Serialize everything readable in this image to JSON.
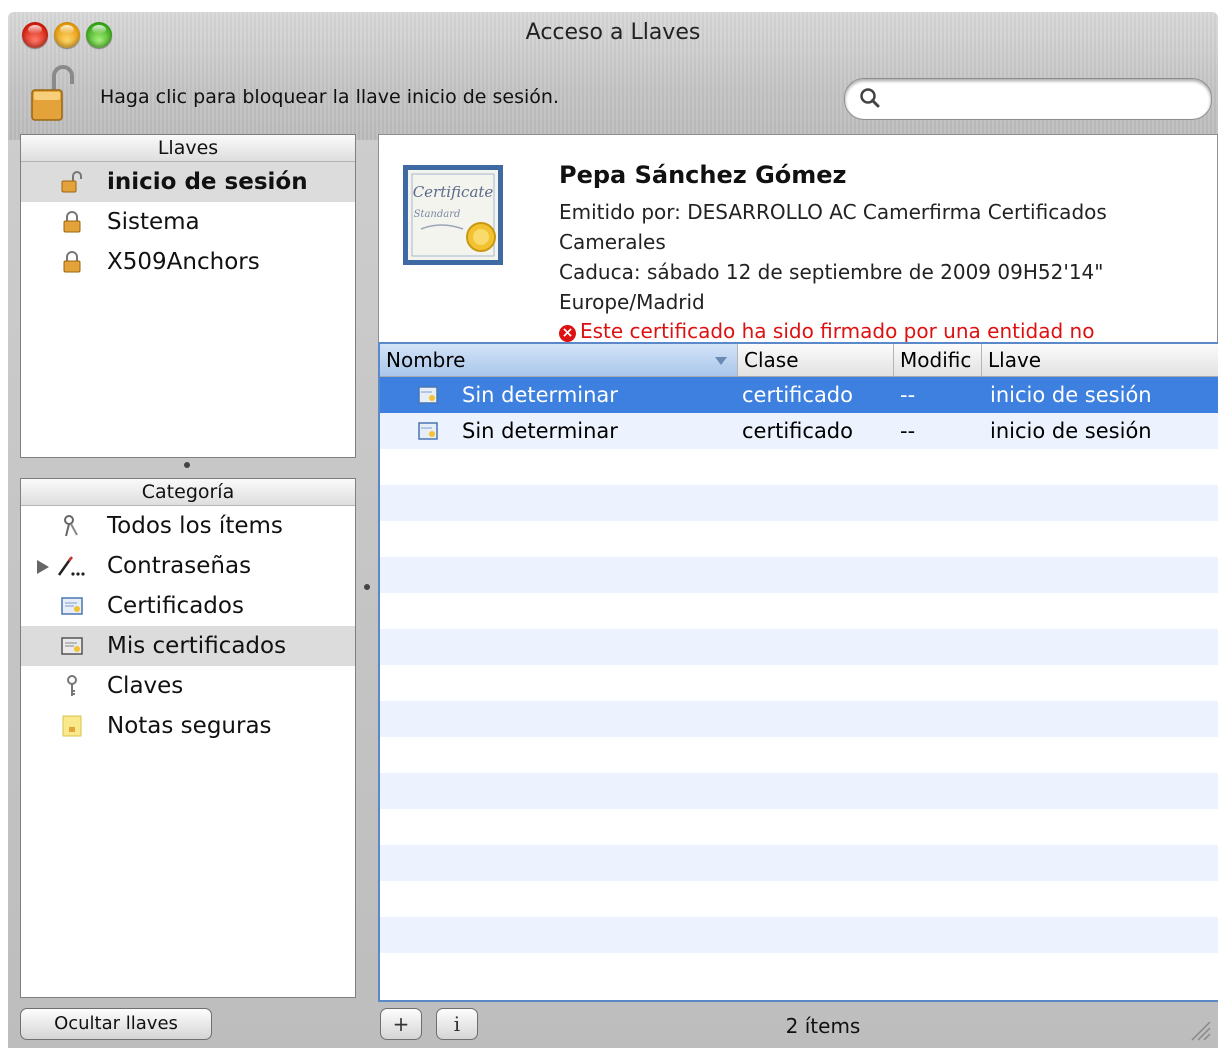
{
  "window": {
    "title": "Acceso a Llaves"
  },
  "toolbar": {
    "lock_text": "Haga clic para bloquear la llave inicio de sesión.",
    "search_placeholder": ""
  },
  "keychains": {
    "header": "Llaves",
    "items": [
      {
        "label": "inicio de sesión",
        "icon": "unlocked-padlock-icon",
        "selected": true
      },
      {
        "label": "Sistema",
        "icon": "padlock-icon"
      },
      {
        "label": "X509Anchors",
        "icon": "padlock-icon"
      }
    ]
  },
  "categories": {
    "header": "Categoría",
    "items": [
      {
        "label": "Todos los ítems",
        "icon": "keys-icon"
      },
      {
        "label": "Contraseñas",
        "icon": "pen-icon",
        "expandable": true
      },
      {
        "label": "Certificados",
        "icon": "certificate-icon"
      },
      {
        "label": "Mis certificados",
        "icon": "my-certificate-icon",
        "selected": true
      },
      {
        "label": "Claves",
        "icon": "key-icon"
      },
      {
        "label": "Notas seguras",
        "icon": "secure-note-icon"
      }
    ]
  },
  "detail": {
    "name": "Pepa Sánchez Gómez",
    "issuer_line1": "Emitido por: DESARROLLO AC Camerfirma Certificados",
    "issuer_line2": "Camerales",
    "expires_line1": "Caduca: sábado 12 de septiembre de 2009 09H52'14\"",
    "expires_line2": "Europe/Madrid",
    "warning": "Este certificado ha sido firmado por una entidad no"
  },
  "table": {
    "columns": [
      "Nombre",
      "Clase",
      "Modific",
      "Llave"
    ],
    "rows": [
      {
        "name": "Sin determinar",
        "kind": "certificado",
        "modified": "--",
        "keychain": "inicio de sesión",
        "selected": true
      },
      {
        "name": "Sin determinar",
        "kind": "certificado",
        "modified": "--",
        "keychain": "inicio de sesión"
      }
    ]
  },
  "bottom": {
    "hide_button": "Ocultar llaves",
    "add_button": "+",
    "info_button": "i",
    "item_count": "2 ítems"
  },
  "colors": {
    "selection": "#3d80df",
    "stripe": "#edf3fe",
    "warning": "#dd1111"
  }
}
